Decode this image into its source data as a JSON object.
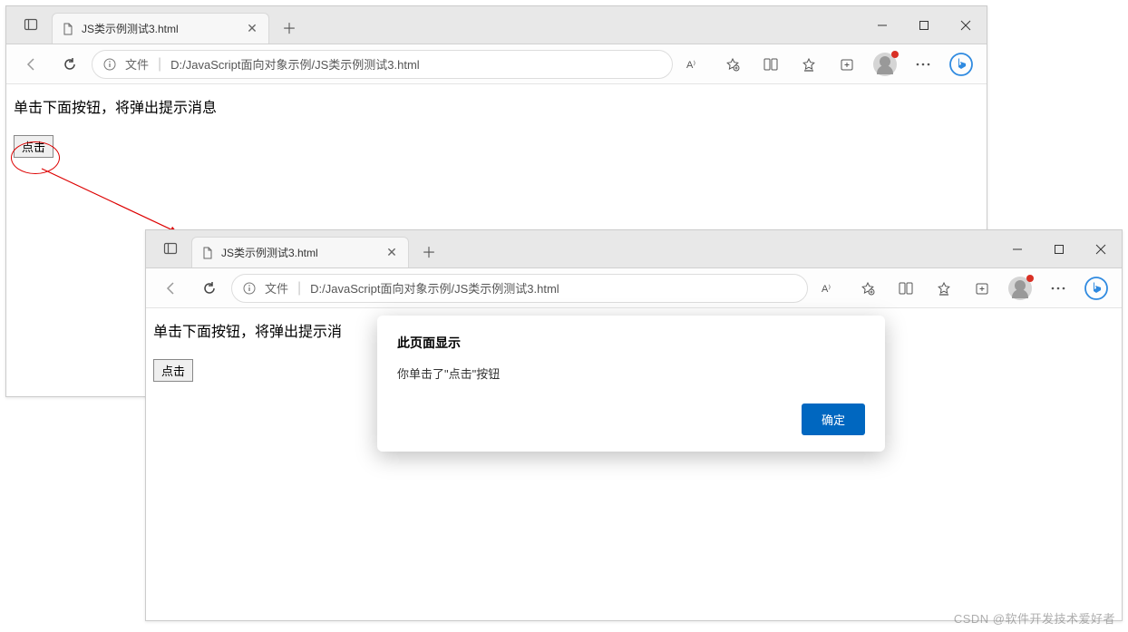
{
  "window1": {
    "tab_title": "JS类示例测试3.html",
    "addr_prefix_label": "文件",
    "addr_path": "D:/JavaScript面向对象示例/JS类示例测试3.html",
    "page_text": "单击下面按钮，将弹出提示消息",
    "button_label": "点击"
  },
  "window2": {
    "tab_title": "JS类示例测试3.html",
    "addr_prefix_label": "文件",
    "addr_path": "D:/JavaScript面向对象示例/JS类示例测试3.html",
    "page_text": "单击下面按钮，将弹出提示消",
    "button_label": "点击"
  },
  "alert": {
    "title": "此页面显示",
    "message": "你单击了\"点击\"按钮",
    "ok_label": "确定"
  },
  "watermark": "CSDN @软件开发技术爱好者"
}
